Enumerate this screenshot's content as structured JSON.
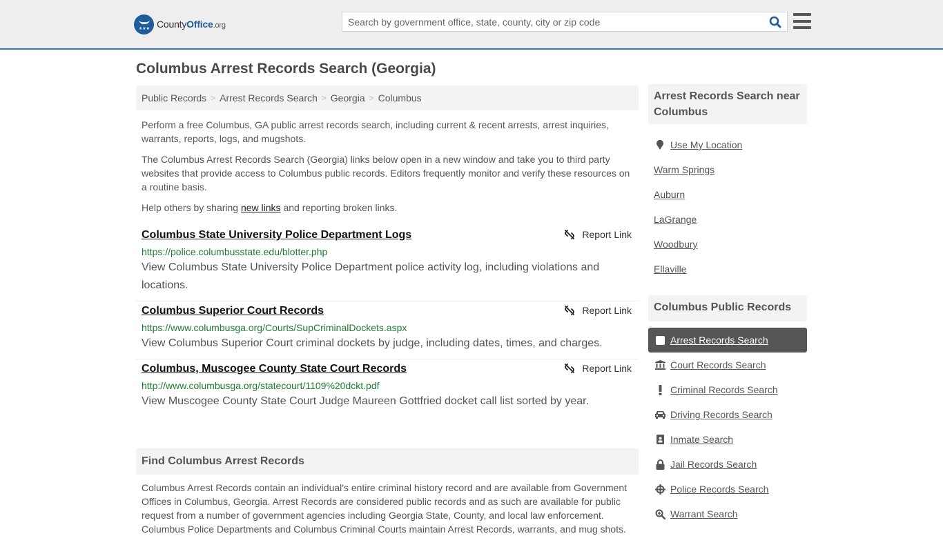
{
  "header": {
    "logo": {
      "county": "County",
      "office": "Office",
      "org": ".org"
    },
    "search": {
      "placeholder": "Search by government office, state, county, city or zip code",
      "value": ""
    },
    "colors": {
      "brand": "#1e5c9c",
      "accent_border": "#3a78a9"
    }
  },
  "page": {
    "title": "Columbus Arrest Records Search (Georgia)",
    "breadcrumb": [
      "Public Records",
      "Arrest Records Search",
      "Georgia",
      "Columbus"
    ],
    "intro": {
      "p1": "Perform a free Columbus, GA public arrest records search, including current & recent arrests, arrest inquiries, warrants, reports, logs, and mugshots.",
      "p2": "The Columbus Arrest Records Search (Georgia) links below open in a new window and take you to third party websites that provide access to Columbus public records. Editors frequently monitor and verify these resources on a routine basis.",
      "p3_before": "Help others by sharing ",
      "p3_link": "new links",
      "p3_after": " and reporting broken links."
    },
    "report_label": "Report Link",
    "links": [
      {
        "title": "Columbus State University Police Department Logs",
        "url": "https://police.columbusstate.edu/blotter.php",
        "description": "View Columbus State University Police Department police activity log, including violations and locations."
      },
      {
        "title": "Columbus Superior Court Records",
        "url": "https://www.columbusga.org/Courts/SupCriminalDockets.aspx",
        "description": "View Columbus Superior Court criminal dockets by judge, including dates, times, and charges."
      },
      {
        "title": "Columbus, Muscogee County State Court Records",
        "url": "http://www.columbusga.org/statecourt/1109%20dckt.pdf",
        "description": "View Muscogee County State Court Judge Maureen Gottfried docket call list sorted by year."
      }
    ],
    "find": {
      "heading": "Find Columbus Arrest Records",
      "body": "Columbus Arrest Records contain an individual's entire criminal history record and are available from Government Offices in Columbus, Georgia. Arrest Records are considered public records and as such are available for public request from a number of government agencies including Georgia State, County, and local law enforcement. Columbus Police Departments and Columbus Criminal Courts maintain Arrest Records, warrants, and mug shots."
    }
  },
  "sidebar": {
    "nearby": {
      "heading": "Arrest Records Search near Columbus",
      "use_location": "Use My Location",
      "places": [
        "Warm Springs",
        "Auburn",
        "LaGrange",
        "Woodbury",
        "Ellaville"
      ]
    },
    "public_records": {
      "heading": "Columbus Public Records",
      "items": [
        {
          "label": "Arrest Records Search",
          "icon": "square-icon",
          "active": true
        },
        {
          "label": "Court Records Search",
          "icon": "courthouse-icon",
          "active": false
        },
        {
          "label": "Criminal Records Search",
          "icon": "exclamation-icon",
          "active": false
        },
        {
          "label": "Driving Records Search",
          "icon": "car-icon",
          "active": false
        },
        {
          "label": "Inmate Search",
          "icon": "id-badge-icon",
          "active": false
        },
        {
          "label": "Jail Records Search",
          "icon": "lock-icon",
          "active": false
        },
        {
          "label": "Police Records Search",
          "icon": "crosshairs-icon",
          "active": false
        },
        {
          "label": "Warrant Search",
          "icon": "search-plus-icon",
          "active": false
        }
      ]
    }
  }
}
